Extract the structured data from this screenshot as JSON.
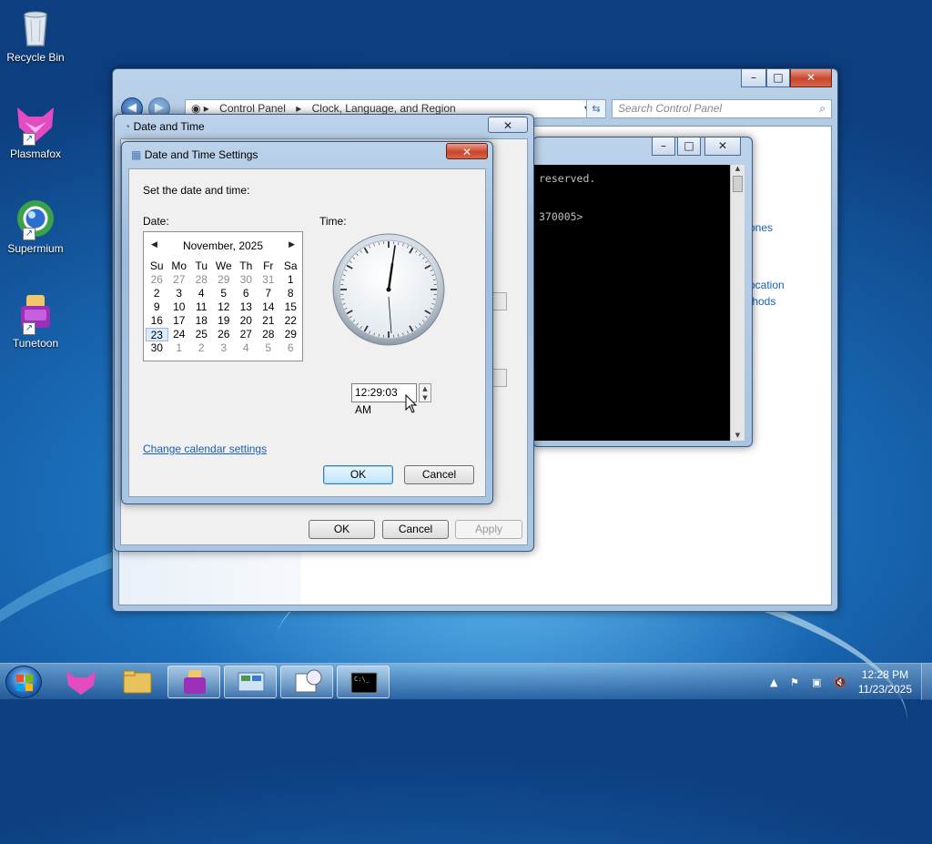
{
  "desktop": {
    "icons": [
      {
        "label": "Recycle Bin"
      },
      {
        "label": "Plasmafox"
      },
      {
        "label": "Supermium"
      },
      {
        "label": "Tunetoon"
      }
    ]
  },
  "control_panel": {
    "breadcrumb": [
      "Control Panel",
      "Clock, Language, and Region"
    ],
    "search_placeholder": "Search Control Panel",
    "links": [
      "ones",
      "ocation",
      "thods"
    ]
  },
  "console": {
    "lines": [
      "reserved.",
      "",
      "",
      "370005>"
    ]
  },
  "date_time_dialog": {
    "title": "Date and Time",
    "buttons": {
      "ok": "OK",
      "cancel": "Cancel",
      "apply": "Apply"
    }
  },
  "settings_dialog": {
    "title": "Date and Time Settings",
    "instruction": "Set the date and time:",
    "date_label": "Date:",
    "time_label": "Time:",
    "calendar": {
      "month_year": "November, 2025",
      "weekdays": [
        "Su",
        "Mo",
        "Tu",
        "We",
        "Th",
        "Fr",
        "Sa"
      ],
      "weeks": [
        [
          "26",
          "27",
          "28",
          "29",
          "30",
          "31",
          "1"
        ],
        [
          "2",
          "3",
          "4",
          "5",
          "6",
          "7",
          "8"
        ],
        [
          "9",
          "10",
          "11",
          "12",
          "13",
          "14",
          "15"
        ],
        [
          "16",
          "17",
          "18",
          "19",
          "20",
          "21",
          "22"
        ],
        [
          "23",
          "24",
          "25",
          "26",
          "27",
          "28",
          "29"
        ],
        [
          "30",
          "1",
          "2",
          "3",
          "4",
          "5",
          "6"
        ]
      ],
      "selected_day": "23"
    },
    "time_value": "12:29:03 AM",
    "change_calendar_link": "Change calendar settings",
    "buttons": {
      "ok": "OK",
      "cancel": "Cancel"
    }
  },
  "taskbar": {
    "time": "12:28 PM",
    "date": "11/23/2025"
  }
}
